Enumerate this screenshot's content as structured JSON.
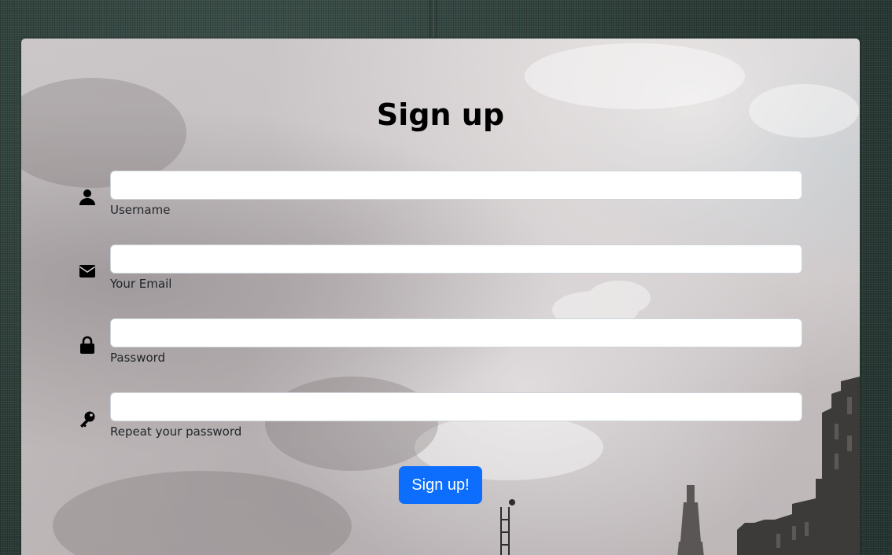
{
  "page": {
    "title": "Sign up"
  },
  "fields": [
    {
      "label": "Username",
      "value": "",
      "icon": "user-icon"
    },
    {
      "label": "Your Email",
      "value": "",
      "icon": "envelope-icon"
    },
    {
      "label": "Password",
      "value": "",
      "icon": "lock-icon"
    },
    {
      "label": "Repeat your password",
      "value": "",
      "icon": "key-icon"
    }
  ],
  "submit": {
    "label": "Sign up!"
  },
  "colors": {
    "button": "#0d6efd",
    "button_text": "#ffffff",
    "background_fabric": "#2f413c"
  }
}
